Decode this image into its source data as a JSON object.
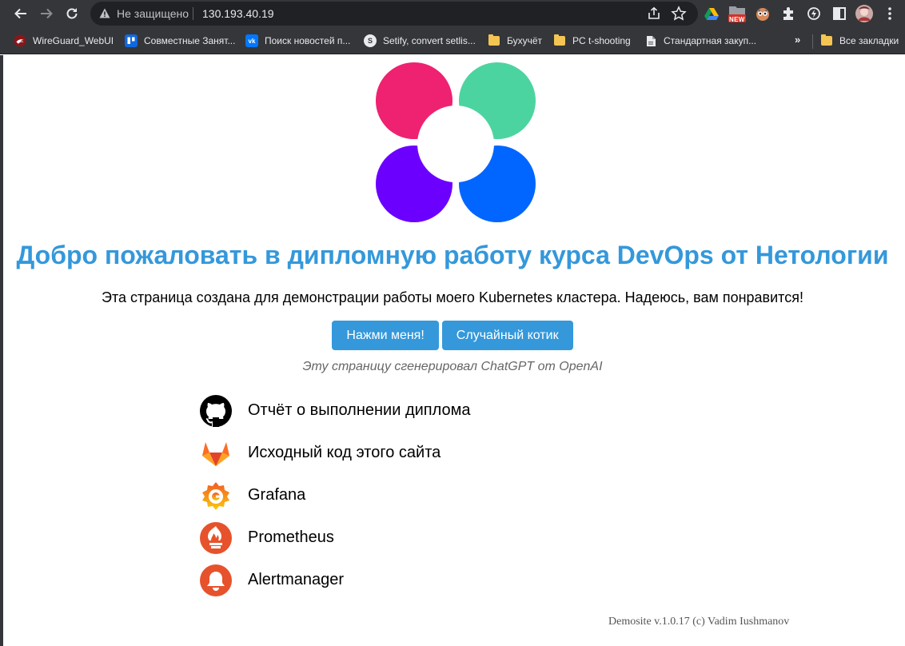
{
  "browser": {
    "security_label": "Не защищено",
    "url": "130.193.40.19",
    "ext_badge": "NEW",
    "bookmarks": [
      {
        "label": "WireGuard_WebUI",
        "icon": "wireguard-icon"
      },
      {
        "label": "Совместные Занят...",
        "icon": "trello-icon"
      },
      {
        "label": "Поиск новостей п...",
        "icon": "vk-icon"
      },
      {
        "label": "Setify, convert setlis...",
        "icon": "setify-icon"
      },
      {
        "label": "Бухучёт",
        "icon": "folder-icon"
      },
      {
        "label": "PC t-shooting",
        "icon": "folder-icon"
      },
      {
        "label": "Стандартная закуп...",
        "icon": "page-icon"
      }
    ],
    "all_bookmarks_label": "Все закладки",
    "more_bookmarks": "»"
  },
  "page": {
    "logo_colors": [
      "#ee2270",
      "#4cd4a0",
      "#6b00ff",
      "#0066ff"
    ],
    "heading": "Добро пожаловать в дипломную работу курса DevOps от Нетологии",
    "intro": "Эта страница создана для демонстрации работы моего Kubernetes кластера. Надеюсь, вам понравится!",
    "buttons": {
      "press_me": "Нажми меня!",
      "random_cat": "Случайный котик"
    },
    "credit": "Эту страницу сгенерировал ChatGPT от OpenAI",
    "links": [
      {
        "label": "Отчёт о выполнении диплома",
        "icon": "github-icon"
      },
      {
        "label": "Исходный код этого сайта",
        "icon": "gitlab-icon"
      },
      {
        "label": "Grafana",
        "icon": "grafana-icon"
      },
      {
        "label": "Prometheus",
        "icon": "prometheus-icon"
      },
      {
        "label": "Alertmanager",
        "icon": "alertmanager-icon"
      }
    ],
    "footer": "Demosite v.1.0.17 (c) Vadim Iushmanov"
  },
  "colors": {
    "accent": "#3498db",
    "chrome": "#35363a",
    "omnibox": "#202124"
  }
}
